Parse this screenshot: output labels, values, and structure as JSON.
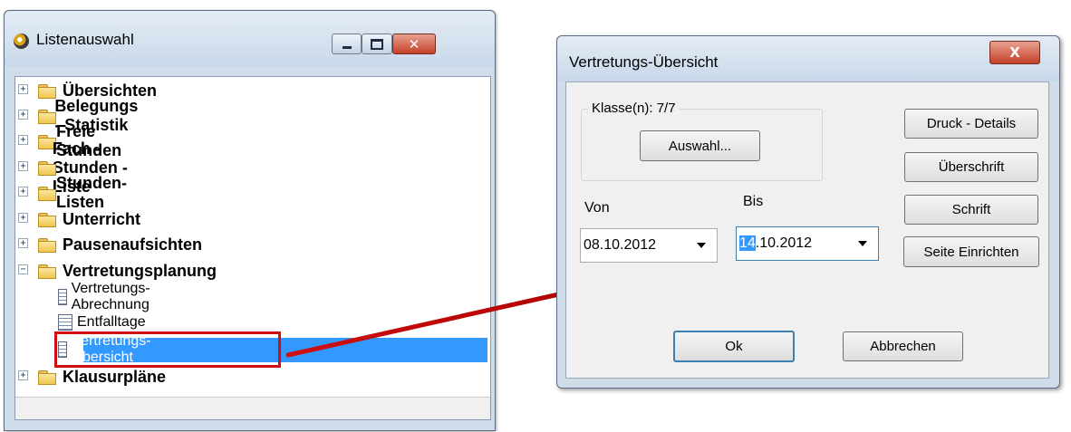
{
  "left_window": {
    "title": "Listenauswahl",
    "tree": [
      {
        "label": "Übersichten",
        "expander": "+"
      },
      {
        "label": "Belegungs - Statistik",
        "expander": "+"
      },
      {
        "label": "Freie Stunden",
        "expander": "+"
      },
      {
        "label": "Fach - Stunden - Liste",
        "expander": "+"
      },
      {
        "label": "Stunden-Listen",
        "expander": "+"
      },
      {
        "label": "Unterricht",
        "expander": "+"
      },
      {
        "label": "Pausenaufsichten",
        "expander": "+"
      },
      {
        "label": "Vertretungsplanung",
        "expander": "−"
      }
    ],
    "children": [
      {
        "label": "Vertretungs-Abrechnung"
      },
      {
        "label": "Entfalltage"
      },
      {
        "label": "Vertretungs-Übersicht",
        "selected": true
      }
    ],
    "after": {
      "label": "Klausurpläne",
      "expander": "+"
    }
  },
  "dialog": {
    "title": "Vertretungs-Übersicht",
    "close_glyph": "X",
    "group_label": "Klasse(n): 7/7",
    "auswahl_button": "Auswahl...",
    "von_label": "Von",
    "bis_label": "Bis",
    "von_value": "08.10.2012",
    "bis_value_selected": "14",
    "bis_value_rest": ".10.2012",
    "buttons": {
      "druck_details": "Druck - Details",
      "ueberschrift": "Überschrift",
      "schrift": "Schrift",
      "seite_einrichten": "Seite Einrichten",
      "ok": "Ok",
      "abbrechen": "Abbrechen"
    }
  },
  "colors": {
    "selection": "#3399ff",
    "highlight_red": "#d01010",
    "window_frame": "#cfdcea"
  }
}
